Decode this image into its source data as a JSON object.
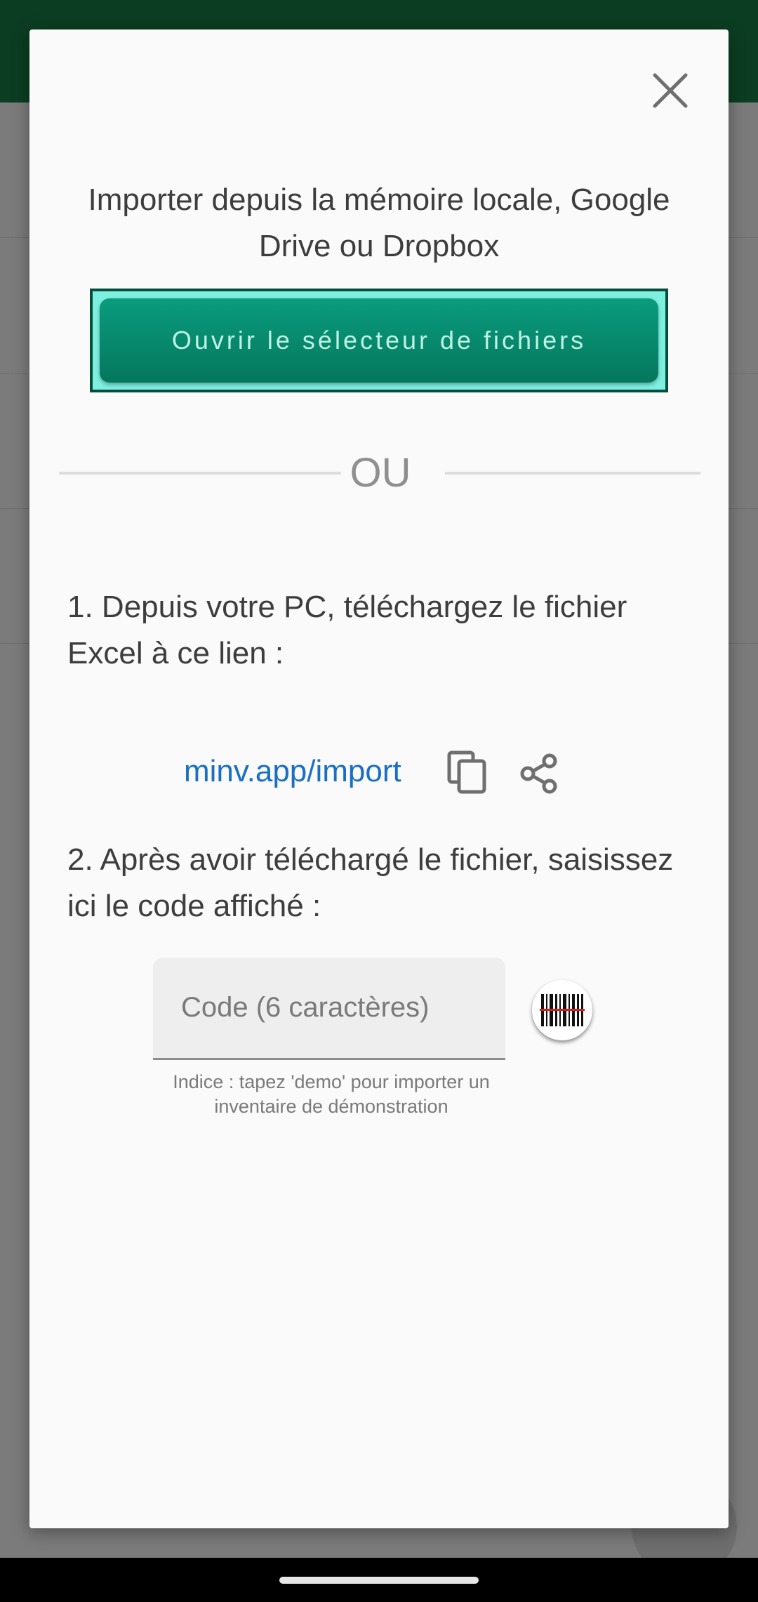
{
  "dialog": {
    "close_icon": "close-icon",
    "intro_text": "Importer depuis la mémoire locale, Google Drive ou Dropbox",
    "open_picker_label": "Ouvrir le sélecteur de fichiers",
    "divider_label": "OU",
    "step1_text": "1. Depuis votre PC, téléchargez le fichier Excel à ce lien :",
    "import_link": "minv.app/import",
    "copy_icon": "copy-icon",
    "share_icon": "share-icon",
    "step2_text": "2. Après avoir téléchargé le fichier, saisissez ici le code affiché :",
    "code_placeholder": "Code (6 caractères)",
    "scan_icon": "barcode-scan-icon",
    "hint_text": "Indice : tapez 'demo' pour importer un inventaire de démonstration"
  },
  "colors": {
    "primary_button": "#05775d",
    "button_highlight": "#7ef0e0",
    "link": "#1a6fc4",
    "app_bar": "#0b3d22"
  }
}
